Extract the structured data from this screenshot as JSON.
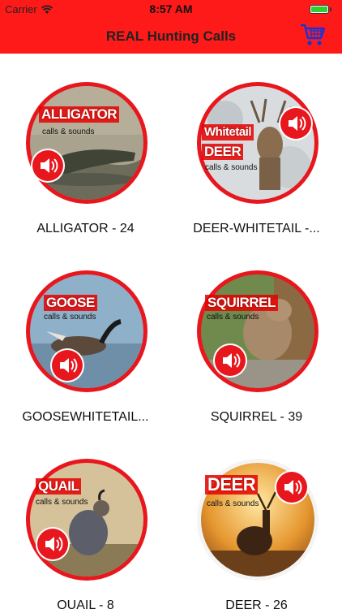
{
  "status_bar": {
    "carrier": "Carrier",
    "time": "8:57 AM"
  },
  "nav": {
    "title": "REAL Hunting Calls",
    "cart_icon": "cart-icon"
  },
  "colors": {
    "accent": "#ff1a1a",
    "circle": "#e8161d"
  },
  "items": [
    {
      "title": "ALLIGATOR",
      "title2": "",
      "subtitle": "calls & sounds",
      "label": "ALLIGATOR - 24"
    },
    {
      "title": "Whitetail",
      "title2": "DEER",
      "subtitle": "calls & sounds",
      "label": "DEER-WHITETAIL -..."
    },
    {
      "title": "GOOSE",
      "title2": "",
      "subtitle": "calls & sounds",
      "label": "GOOSEWHITETAIL..."
    },
    {
      "title": "SQUIRREL",
      "title2": "",
      "subtitle": "calls & sounds",
      "label": "SQUIRREL - 39"
    },
    {
      "title": "QUAIL",
      "title2": "",
      "subtitle": "calls & sounds",
      "label": "QUAIL - 8"
    },
    {
      "title": "DEER",
      "title2": "",
      "subtitle": "calls & sounds",
      "label": "DEER - 26"
    }
  ]
}
